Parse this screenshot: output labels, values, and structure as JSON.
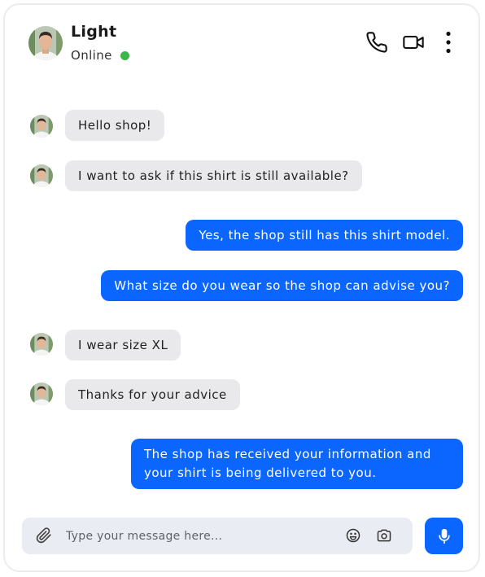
{
  "header": {
    "name": "Light",
    "status": "Online",
    "status_color": "#3cb64a",
    "icons": [
      "phone-icon",
      "video-camera-icon",
      "more-vertical-icon"
    ]
  },
  "messages": [
    {
      "direction": "incoming",
      "text": "Hello shop!"
    },
    {
      "direction": "incoming",
      "text": "I want to ask if this shirt is still available?"
    },
    {
      "direction": "outgoing",
      "text": "Yes, the shop still has this shirt model."
    },
    {
      "direction": "outgoing",
      "text": "What size do you wear so the shop can advise you?"
    },
    {
      "direction": "incoming",
      "text": "I wear size XL"
    },
    {
      "direction": "incoming",
      "text": "Thanks for your advice"
    },
    {
      "direction": "outgoing",
      "text": "The shop has received your information and your shirt is being delivered to you."
    }
  ],
  "composer": {
    "placeholder": "Type your message here...",
    "icons": [
      "paperclip-icon",
      "emoji-icon",
      "camera-icon",
      "microphone-icon"
    ]
  },
  "colors": {
    "outgoing_bubble": "#0b66ff",
    "incoming_bubble": "#e9e9ec",
    "composer_bg": "#e9ecf2"
  }
}
